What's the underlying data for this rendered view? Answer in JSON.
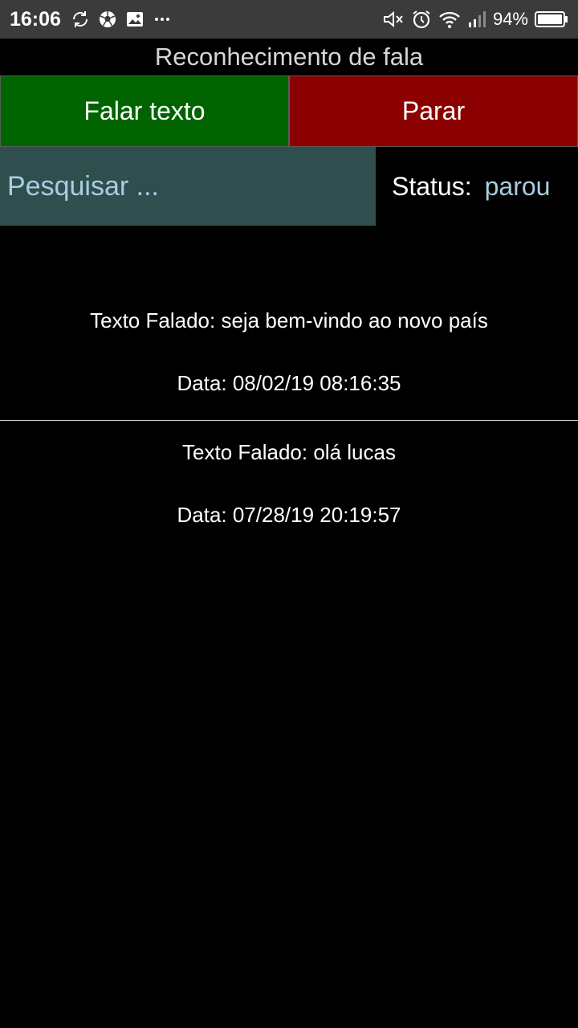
{
  "status_bar": {
    "time": "16:06",
    "battery": "94%",
    "left_icons": [
      "sync-icon",
      "soccer-ball-icon",
      "image-icon",
      "more-dots-icon"
    ],
    "right_icons": [
      "mute-icon",
      "alarm-icon",
      "wifi-icon",
      "signal-icon",
      "battery-icon"
    ]
  },
  "app": {
    "title": "Reconhecimento de fala"
  },
  "buttons": {
    "speak_label": "Falar texto",
    "stop_label": "Parar",
    "speak_color": "#006400",
    "stop_color": "#8b0000"
  },
  "search": {
    "placeholder": "Pesquisar ...",
    "value": ""
  },
  "status": {
    "label": "Status:",
    "value": "parou"
  },
  "history": [
    {
      "text": "Texto Falado: seja bem-vindo ao novo país",
      "date": "Data: 08/02/19 08:16:35"
    },
    {
      "text": "Texto Falado: olá lucas",
      "date": "Data: 07/28/19 20:19:57"
    }
  ]
}
